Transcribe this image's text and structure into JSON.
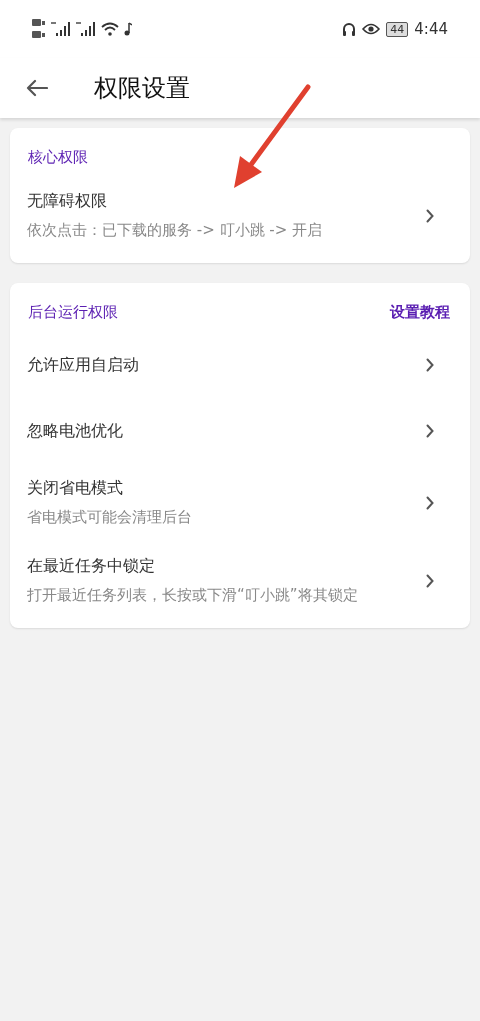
{
  "status_bar": {
    "battery": "44",
    "time": "4:44"
  },
  "app_bar": {
    "title": "权限设置"
  },
  "sections": [
    {
      "title": "核心权限",
      "items": [
        {
          "title": "无障碍权限",
          "subtitle": "依次点击：已下载的服务 -> 叮小跳 -> 开启"
        }
      ]
    },
    {
      "title": "后台运行权限",
      "action": "设置教程",
      "items": [
        {
          "title": "允许应用自启动"
        },
        {
          "title": "忽略电池优化"
        },
        {
          "title": "关闭省电模式",
          "subtitle": "省电模式可能会清理后台"
        },
        {
          "title": "在最近任务中锁定",
          "subtitle": "打开最近任务列表，长按或下滑“叮小跳”将其锁定"
        }
      ]
    }
  ]
}
